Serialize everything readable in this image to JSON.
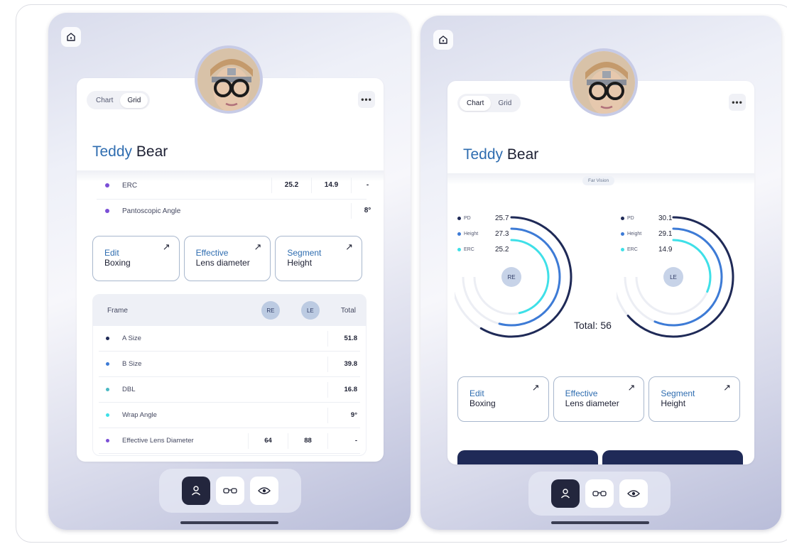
{
  "colors": {
    "accent": "#2f6db0",
    "dark": "#23263d",
    "navy": "#1f2a57",
    "dot_purple": "#7b4fd6",
    "dot_navy": "#1f2a57",
    "dot_blue": "#3d7bd6",
    "dot_teal": "#4ab9c4",
    "dot_cyan": "#3ee0e8"
  },
  "left": {
    "toggle": {
      "chart": "Chart",
      "grid": "Grid",
      "active": "Grid"
    },
    "more_label": "•••",
    "name": {
      "first": "Teddy",
      "last": "Bear"
    },
    "top_rows": [
      {
        "label": "ERC",
        "re": "25.2",
        "le": "14.9",
        "total": "-",
        "dot": "#7b4fd6"
      },
      {
        "label": "Pantoscopic Angle",
        "re": "",
        "le": "",
        "total": "8°",
        "dot": "#7b4fd6"
      }
    ],
    "actions": [
      {
        "top": "Edit",
        "bottom": "Boxing",
        "arrow": "↗"
      },
      {
        "top": "Effective",
        "bottom": "Lens diameter",
        "arrow": "↗"
      },
      {
        "top": "Segment",
        "bottom": "Height",
        "arrow": "↗"
      }
    ],
    "frame_table": {
      "title": "Frame",
      "re": "RE",
      "le": "LE",
      "total": "Total",
      "rows": [
        {
          "label": "A Size",
          "re": "",
          "le": "",
          "total": "51.8",
          "dot": "#1f2a57"
        },
        {
          "label": "B Size",
          "re": "",
          "le": "",
          "total": "39.8",
          "dot": "#3d7bd6"
        },
        {
          "label": "DBL",
          "re": "",
          "le": "",
          "total": "16.8",
          "dot": "#4ab9c4"
        },
        {
          "label": "Wrap Angle",
          "re": "",
          "le": "",
          "total": "9°",
          "dot": "#3ee0e8"
        },
        {
          "label": "Effective Lens Diameter",
          "re": "64",
          "le": "88",
          "total": "-",
          "dot": "#7b4fd6"
        }
      ]
    }
  },
  "right": {
    "toggle": {
      "chart": "Chart",
      "grid": "Grid",
      "active": "Chart"
    },
    "more_label": "•••",
    "name": {
      "first": "Teddy",
      "last": "Bear"
    },
    "far_vision": "Far Vision",
    "re_gauge": {
      "label": "RE",
      "items": [
        {
          "name": "PD",
          "value": "25.7",
          "fraction": 0.78,
          "color": "#1f2a57"
        },
        {
          "name": "Height",
          "value": "27.3",
          "fraction": 0.72,
          "color": "#3d7bd6"
        },
        {
          "name": "ERC",
          "value": "25.2",
          "fraction": 0.62,
          "color": "#3ee0e8"
        }
      ]
    },
    "le_gauge": {
      "label": "LE",
      "items": [
        {
          "name": "PD",
          "value": "30.1",
          "fraction": 0.85,
          "color": "#1f2a57"
        },
        {
          "name": "Height",
          "value": "29.1",
          "fraction": 0.75,
          "color": "#3d7bd6"
        },
        {
          "name": "ERC",
          "value": "14.9",
          "fraction": 0.42,
          "color": "#3ee0e8"
        }
      ]
    },
    "total": "Total: 56",
    "actions": [
      {
        "top": "Edit",
        "bottom": "Boxing",
        "arrow": "↗"
      },
      {
        "top": "Effective",
        "bottom": "Lens diameter",
        "arrow": "↗"
      },
      {
        "top": "Segment",
        "bottom": "Height",
        "arrow": "↗"
      }
    ]
  },
  "dock": {
    "items": [
      {
        "icon": "person-icon",
        "active": true
      },
      {
        "icon": "glasses-icon",
        "active": false
      },
      {
        "icon": "eye-icon",
        "active": false
      }
    ]
  }
}
